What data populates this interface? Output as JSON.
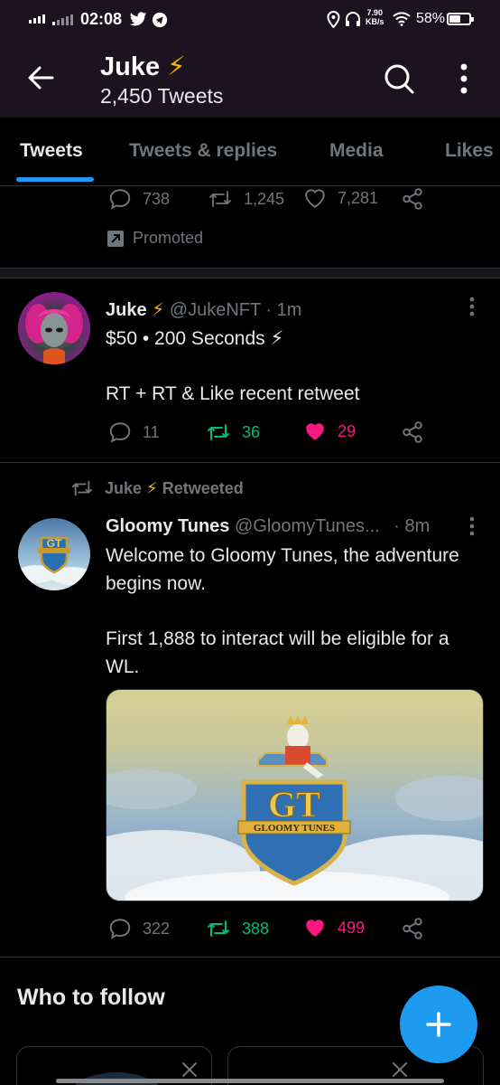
{
  "status_bar": {
    "time": "02:08",
    "net_speed_value": "7.90",
    "net_speed_unit": "KB/s",
    "battery": "58%",
    "battery_level": 0.58,
    "icons": [
      "signal-icon",
      "twitter-bird-icon",
      "telegram-icon",
      "location-icon",
      "headphones-icon",
      "wifi-icon",
      "battery-icon"
    ]
  },
  "header": {
    "title": "Juke",
    "title_emoji": "⚡",
    "subtitle": "2,450 Tweets"
  },
  "tabs": [
    "Tweets",
    "Tweets & replies",
    "Media",
    "Likes"
  ],
  "promo_tweet": {
    "reply_count": "738",
    "retweet_count": "1,245",
    "like_count": "7,281",
    "promoted_label": "Promoted"
  },
  "tweet1": {
    "name": "Juke",
    "emoji": "⚡",
    "handle": "@JukeNFT",
    "separator": "·",
    "time": "1m",
    "line1": "$50 • 200 Seconds ⚡",
    "line2": "RT + RT & Like recent retweet",
    "reply_count": "11",
    "retweet_count": "36",
    "like_count": "29"
  },
  "tweet2": {
    "retweet_by": "Juke",
    "retweet_emoji": "⚡",
    "retweet_label": "Retweeted",
    "name": "Gloomy Tunes",
    "handle": "@GloomyTunes...",
    "separator": "·",
    "time": "8m",
    "text_p1": "Welcome to Gloomy Tunes, the adventure begins now.",
    "text_p2": "First 1,888 to interact will be eligible for a WL.",
    "image_banner_text": "GLOOMY TUNES",
    "image_logo_text": "GT",
    "reply_count": "322",
    "retweet_count": "388",
    "like_count": "499"
  },
  "who_to_follow": {
    "title": "Who to follow"
  },
  "colors": {
    "accent": "#1d9bf0",
    "like_pink": "#f91880",
    "retweet_green": "#00ba7c",
    "muted": "#71767b",
    "header_bg": "#1c1320"
  }
}
